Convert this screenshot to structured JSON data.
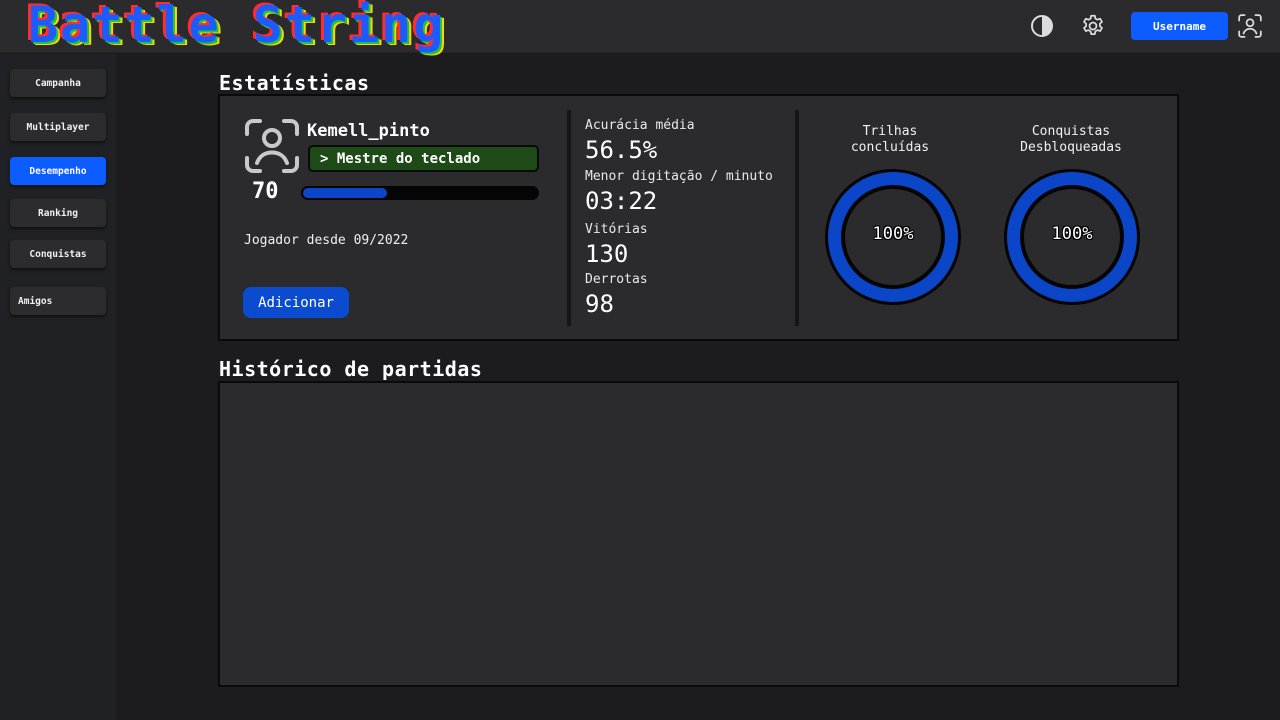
{
  "app": {
    "title": "Battle String",
    "user_button": "Username"
  },
  "header": {
    "icons": [
      "contrast-icon",
      "gear-icon",
      "user-profile-icon"
    ]
  },
  "sidebar": {
    "items": [
      {
        "label": "Campanha",
        "active": false
      },
      {
        "label": "Multiplayer",
        "active": false
      },
      {
        "label": "Desempenho",
        "active": true
      },
      {
        "label": "Ranking",
        "active": false
      },
      {
        "label": "Conquistas",
        "active": false
      },
      {
        "label": "Amigos",
        "active": false
      }
    ]
  },
  "stats": {
    "title": "Estatísticas",
    "profile": {
      "username": "Kemell_pinto",
      "rank": "> Mestre do teclado",
      "level": "70",
      "xp_fraction": 0.37,
      "since": "Jogador desde 09/2022",
      "add_button": "Adicionar"
    },
    "metrics": [
      {
        "label": "Acurácia média",
        "value": "56.5%"
      },
      {
        "label": "Menor digitação / minuto",
        "value": "03:22"
      },
      {
        "label": "Vitórias",
        "value": "130"
      },
      {
        "label": "Derrotas",
        "value": "98"
      }
    ],
    "rings": [
      {
        "label_line1": "Trilhas",
        "label_line2": "concluídas",
        "value": "100%",
        "fraction": 1.0
      },
      {
        "label_line1": "Conquistas",
        "label_line2": "Desbloqueadas",
        "value": "100%",
        "fraction": 1.0
      }
    ]
  },
  "history": {
    "title": "Histórico de partidas"
  },
  "colors": {
    "accent": "#0d5cff",
    "ring": "#0b46c9",
    "rank_badge": "#1d4a17",
    "panel": "#2b2b2e"
  }
}
